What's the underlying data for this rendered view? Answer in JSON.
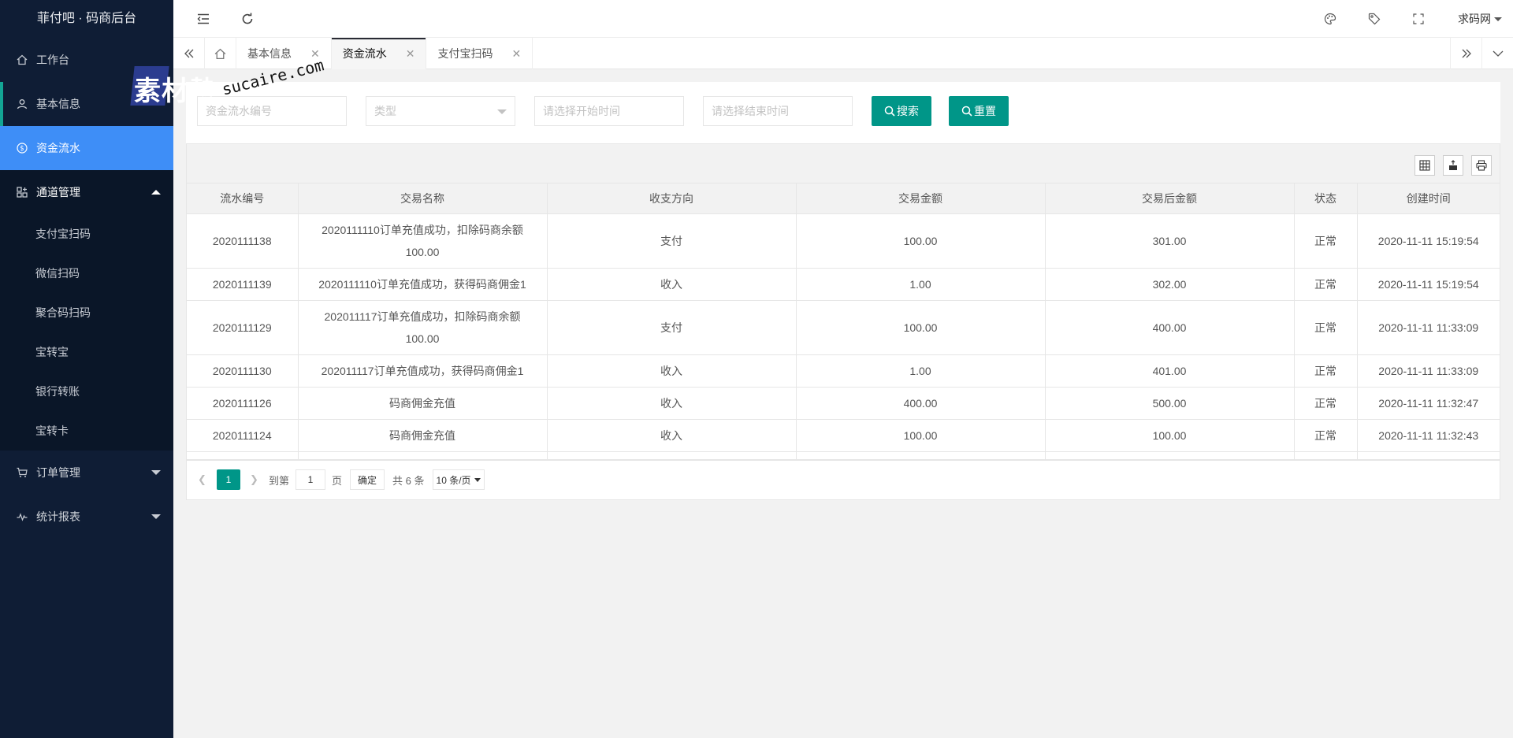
{
  "app": {
    "title": "菲付吧 · 码商后台"
  },
  "sidebar": {
    "items": [
      {
        "label": "工作台",
        "icon": "home-icon"
      },
      {
        "label": "基本信息",
        "icon": "user-icon"
      },
      {
        "label": "资金流水",
        "icon": "dollar-icon"
      },
      {
        "label": "通道管理",
        "icon": "apps-icon"
      }
    ],
    "subitems": [
      "支付宝扫码",
      "微信扫码",
      "聚合码扫码",
      "宝转宝",
      "银行转账",
      "宝转卡"
    ],
    "bottom_items": [
      {
        "label": "订单管理",
        "icon": "cart-icon"
      },
      {
        "label": "统计报表",
        "icon": "chart-line-icon"
      }
    ]
  },
  "header": {
    "user": "求码网"
  },
  "tabs": [
    {
      "label": "基本信息"
    },
    {
      "label": "资金流水"
    },
    {
      "label": "支付宝扫码"
    }
  ],
  "search": {
    "serial_placeholder": "资金流水编号",
    "type_placeholder": "类型",
    "start_placeholder": "请选择开始时间",
    "end_placeholder": "请选择结束时间",
    "search_label": "搜索",
    "reset_label": "重置"
  },
  "table": {
    "headers": [
      "流水编号",
      "交易名称",
      "收支方向",
      "交易金额",
      "交易后金额",
      "状态",
      "创建时间"
    ],
    "rows": [
      [
        "2020111138",
        "2020111110订单充值成功，扣除码商余额100.00",
        "支付",
        "100.00",
        "301.00",
        "正常",
        "2020-11-11 15:19:54"
      ],
      [
        "2020111139",
        "2020111110订单充值成功，获得码商佣金1",
        "收入",
        "1.00",
        "302.00",
        "正常",
        "2020-11-11 15:19:54"
      ],
      [
        "2020111129",
        "202011117订单充值成功，扣除码商余额100.00",
        "支付",
        "100.00",
        "400.00",
        "正常",
        "2020-11-11 11:33:09"
      ],
      [
        "2020111130",
        "202011117订单充值成功，获得码商佣金1",
        "收入",
        "1.00",
        "401.00",
        "正常",
        "2020-11-11 11:33:09"
      ],
      [
        "2020111126",
        "码商佣金充值",
        "收入",
        "400.00",
        "500.00",
        "正常",
        "2020-11-11 11:32:47"
      ],
      [
        "2020111124",
        "码商佣金充值",
        "收入",
        "100.00",
        "100.00",
        "正常",
        "2020-11-11 11:32:43"
      ]
    ]
  },
  "pager": {
    "current": "1",
    "goto_label": "到第",
    "page_value": "1",
    "page_label": "页",
    "confirm_label": "确定",
    "total_label": "共 6 条",
    "size_label": "10 条/页"
  },
  "watermark": {
    "text": "素材熱",
    "url": "sucaire.com"
  },
  "colors": {
    "sidebar": "#0f1d35",
    "active_nav": "#3e8ef7",
    "primary": "#009688"
  }
}
